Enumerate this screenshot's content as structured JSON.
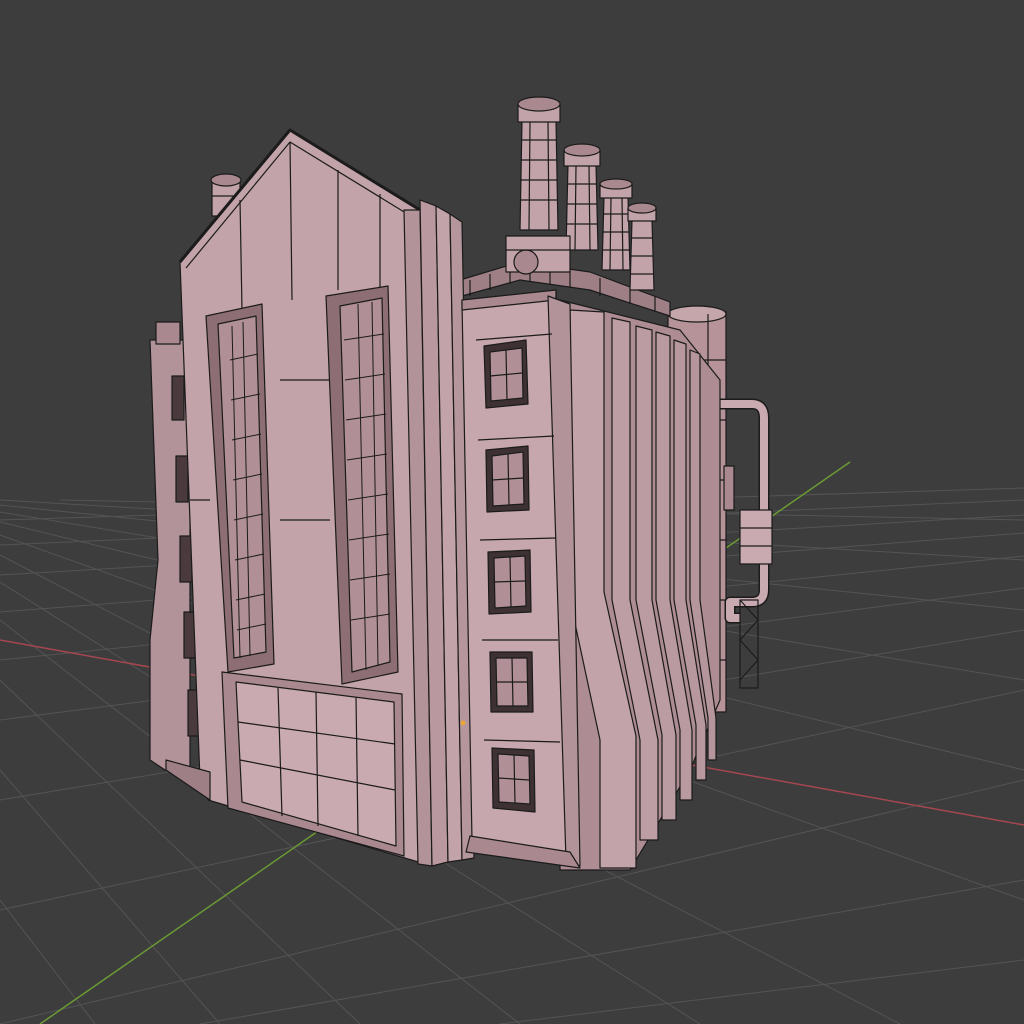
{
  "viewport": {
    "background_color": "#3d3d3d",
    "grid_color": "#545454",
    "x_axis_color": "#a5474f",
    "y_axis_color": "#6a9a34",
    "model_fill_color": "#bfa0a6",
    "model_shade_color": "#a9898f",
    "wire_color": "#1b1b1b",
    "object": "factory-building-model",
    "shading_mode": "solid-with-wireframe-overlay"
  }
}
